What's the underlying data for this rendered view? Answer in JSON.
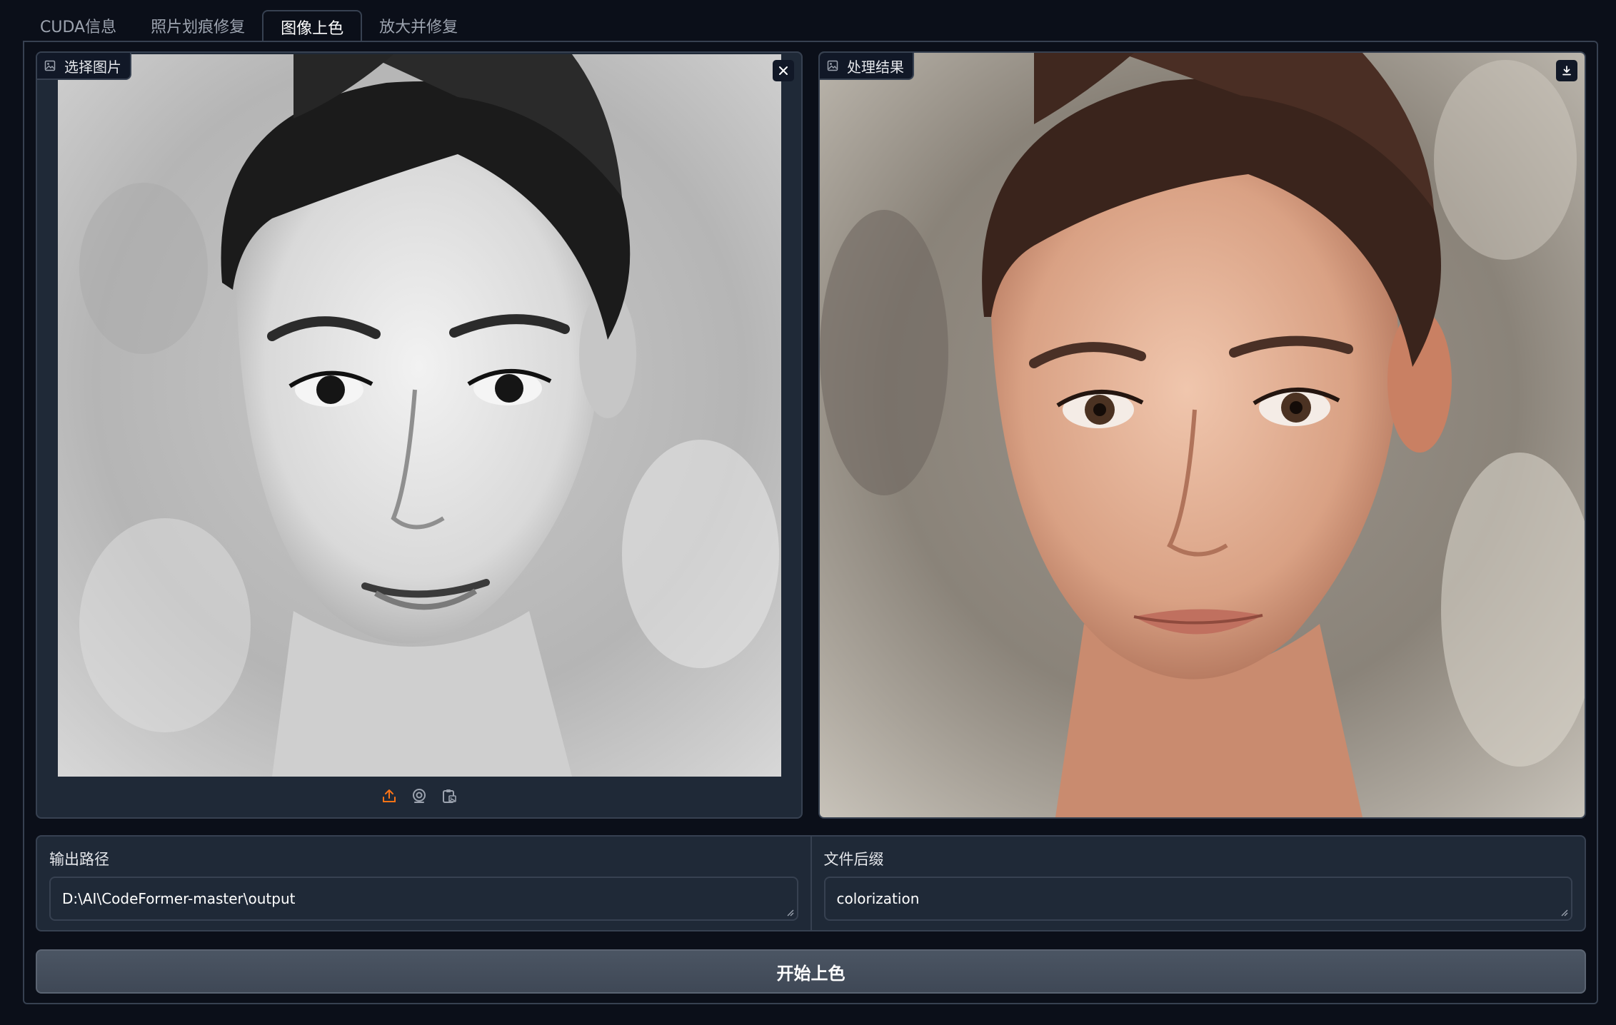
{
  "tabs": [
    {
      "label": "CUDA信息",
      "active": false
    },
    {
      "label": "照片划痕修复",
      "active": false
    },
    {
      "label": "图像上色",
      "active": true
    },
    {
      "label": "放大并修复",
      "active": false
    }
  ],
  "input_image": {
    "label": "选择图片",
    "icon": "image-icon",
    "clear_icon": "close-icon",
    "toolbar": [
      "upload-icon",
      "webcam-icon",
      "clipboard-icon"
    ]
  },
  "output_image": {
    "label": "处理结果",
    "icon": "image-icon",
    "download_icon": "download-icon"
  },
  "output_path": {
    "label": "输出路径",
    "value": "D:\\AI\\CodeFormer-master\\output"
  },
  "file_suffix": {
    "label": "文件后缀",
    "value": "colorization"
  },
  "run_button": {
    "label": "开始上色"
  },
  "colors": {
    "background": "#0b0f19",
    "panel": "#1f2937",
    "border": "#374151",
    "accent": "#f97316",
    "button": "#4b5563"
  }
}
